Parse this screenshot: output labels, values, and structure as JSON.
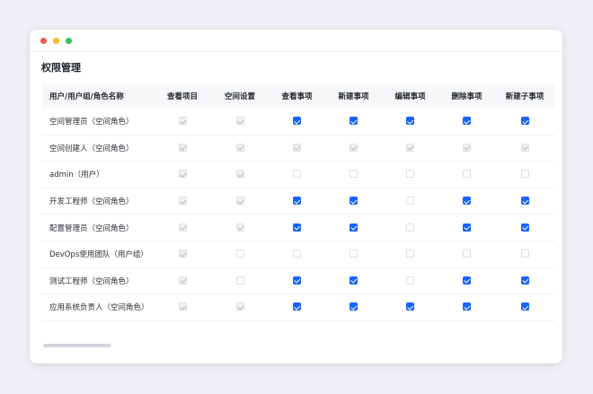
{
  "window": {
    "traffic_lights": [
      {
        "name": "close",
        "color": "#f25a4a"
      },
      {
        "name": "minimize",
        "color": "#f6b830"
      },
      {
        "name": "maximize",
        "color": "#2fc45a"
      }
    ]
  },
  "page_title": "权限管理",
  "table": {
    "columns": [
      "用户/用户组/角色名称",
      "查看项目",
      "空间设置",
      "查看事项",
      "新建事项",
      "编辑事项",
      "删除事项",
      "新建子事项"
    ],
    "rows": [
      {
        "name": "空间管理员（空间角色）",
        "perms": [
          "disabled-checked",
          "disabled-checked",
          "checked",
          "checked",
          "checked",
          "checked",
          "checked"
        ]
      },
      {
        "name": "空间创建人（空间角色）",
        "perms": [
          "disabled-checked",
          "disabled-checked",
          "disabled-checked",
          "disabled-checked",
          "disabled-checked",
          "disabled-checked",
          "disabled-checked"
        ]
      },
      {
        "name": "admin（用户）",
        "perms": [
          "disabled-checked",
          "disabled-checked",
          "unchecked",
          "unchecked",
          "unchecked",
          "unchecked",
          "unchecked"
        ]
      },
      {
        "name": "开发工程师（空间角色）",
        "perms": [
          "disabled-checked",
          "disabled-checked",
          "checked",
          "checked",
          "unchecked",
          "checked",
          "checked"
        ]
      },
      {
        "name": "配置管理员（空间角色）",
        "perms": [
          "disabled-checked",
          "disabled-checked",
          "checked",
          "checked",
          "unchecked",
          "checked",
          "checked"
        ]
      },
      {
        "name": "DevOps使用团队（用户组）",
        "perms": [
          "disabled-checked",
          "unchecked",
          "unchecked",
          "unchecked",
          "unchecked",
          "unchecked",
          "unchecked"
        ]
      },
      {
        "name": "测试工程师（空间角色）",
        "perms": [
          "disabled-checked",
          "unchecked",
          "checked",
          "checked",
          "unchecked",
          "checked",
          "checked"
        ]
      },
      {
        "name": "应用系统负责人（空间角色）",
        "perms": [
          "disabled-checked",
          "disabled-checked",
          "checked",
          "checked",
          "checked",
          "checked",
          "checked"
        ]
      }
    ]
  },
  "colors": {
    "accent": "#1664ff",
    "header_bg": "#f6f7f9"
  }
}
